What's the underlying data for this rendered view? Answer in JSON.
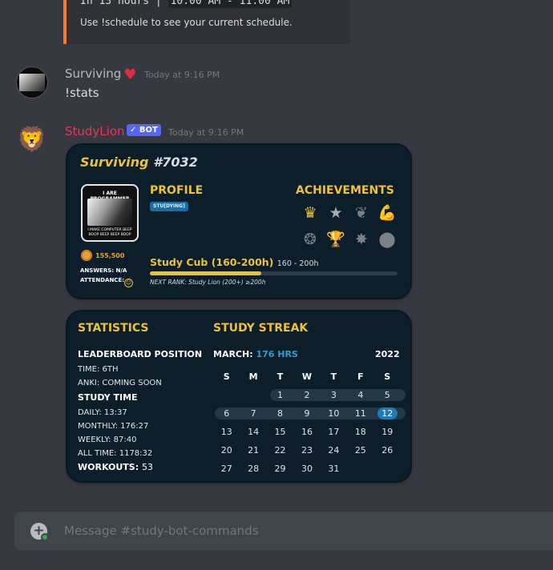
{
  "top_embed": {
    "time_prefix": "In 13 hours",
    "time_range": "10:00 AM - 11:00 AM",
    "hint": "Use !schedule to see your current schedule."
  },
  "msg_user": {
    "username": "Surviving",
    "username_color": "#b9bbbe",
    "timestamp": "Today at 9:16 PM",
    "text": "!stats",
    "avatar": {
      "caption": "I ARE PROGRAMMER"
    }
  },
  "msg_bot": {
    "username": "StudyLion",
    "username_color": "#e8345f",
    "bot_tag": "✓ BOT",
    "timestamp": "Today at 9:16 PM",
    "avatar_icon": "lion-icon"
  },
  "profile_card": {
    "name": "Surviving",
    "discriminator": "#7032",
    "pfp": {
      "top_text": "I ARE PROGRAMMER",
      "bottom_text": "I MAKE COMPUTER BEEP BOOP BEEP BEEP BOOP"
    },
    "coins": "155,500",
    "answers": "ANSWERS: N/A",
    "attendance_label": "ATTENDANCE:",
    "profile_heading": "PROFILE",
    "profile_badge": "STU[DYING]",
    "achievements_heading": "ACHIEVEMENTS",
    "achievements": [
      {
        "icon": "crown-icon",
        "glyph": "♛",
        "tone": "gold"
      },
      {
        "icon": "star-podium-icon",
        "glyph": "★",
        "tone": "silver"
      },
      {
        "icon": "laurel-medal-icon",
        "glyph": "❦",
        "tone": "dim"
      },
      {
        "icon": "flexed-arm-icon",
        "glyph": "💪",
        "tone": "orange"
      },
      {
        "icon": "winged-badge-icon",
        "glyph": "❂",
        "tone": "dim"
      },
      {
        "icon": "trophy-icon",
        "glyph": "🏆",
        "tone": "gold"
      },
      {
        "icon": "star-burst-icon",
        "glyph": "✸",
        "tone": "dim"
      },
      {
        "icon": "medal-icon",
        "glyph": "⬤",
        "tone": "dim"
      }
    ],
    "rank_name": "Study Cub (160-200h)",
    "rank_range": "160 - 200h",
    "rank_progress": 0.45,
    "next_rank": "NEXT RANK: Study Lion (200+) ≥200h"
  },
  "stats_card": {
    "statistics_heading": "STATISTICS",
    "streak_heading": "STUDY STREAK",
    "leaderboard_heading": "LEADERBOARD POSITION",
    "time_rank": "TIME: 6TH",
    "anki": "ANKI: COMING SOON",
    "study_time_heading": "STUDY TIME",
    "daily": "DAILY: 13:37",
    "monthly": "MONTHLY: 176:27",
    "weekly": "WEEKLY: 87:40",
    "all_time": "ALL TIME: 1178:32",
    "workouts_label": "WORKOUTS:",
    "workouts_value": "53",
    "month_label": "MARCH:",
    "month_hours": "176 HRS",
    "year": "2022",
    "weekdays": [
      "S",
      "M",
      "T",
      "W",
      "T",
      "F",
      "S"
    ],
    "weeks": [
      [
        "",
        "",
        "1",
        "2",
        "3",
        "4",
        "5"
      ],
      [
        "6",
        "7",
        "8",
        "9",
        "10",
        "11",
        "12"
      ],
      [
        "13",
        "14",
        "15",
        "16",
        "17",
        "18",
        "19"
      ],
      [
        "20",
        "21",
        "22",
        "23",
        "24",
        "25",
        "26"
      ],
      [
        "27",
        "28",
        "29",
        "30",
        "31",
        "",
        ""
      ]
    ],
    "studied_days": [
      "1",
      "2",
      "3",
      "4",
      "5",
      "6",
      "7",
      "8",
      "9",
      "10",
      "11",
      "12"
    ],
    "today": "12"
  },
  "composer": {
    "placeholder": "Message #study-bot-commands"
  },
  "colors": {
    "background": "#36393f",
    "card_bg": "#0d1e2b",
    "accent_yellow": "#eec230",
    "accent_blue": "#2f9ccf",
    "embed_border": "#f47b2a"
  }
}
